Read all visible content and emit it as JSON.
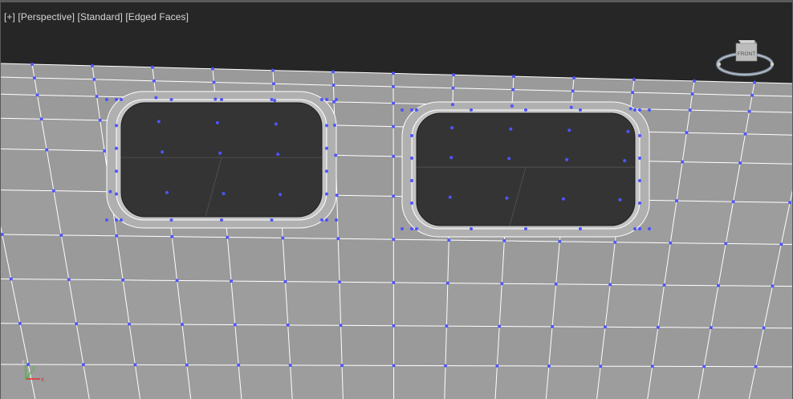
{
  "viewport": {
    "label_parts": [
      "[+]",
      "[Perspective]",
      "[Standard]",
      "[Edged Faces]"
    ],
    "background_color": "#262626",
    "mesh_face_color": "#9a9a9a",
    "mesh_edge_color": "#ffffff",
    "vertex_color": "#4f54ff",
    "hole_color": "#343434"
  },
  "viewcube": {
    "face_label": "FRONT"
  },
  "axis_tripod": {
    "z_label": "z",
    "y_label": "y",
    "x_label": "x"
  }
}
